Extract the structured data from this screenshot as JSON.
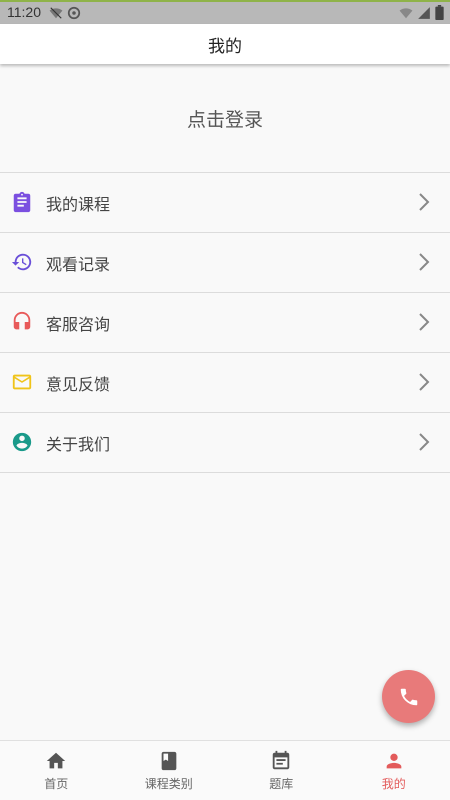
{
  "status_bar": {
    "time": "11:20"
  },
  "app_bar": {
    "title": "我的"
  },
  "login": {
    "label": "点击登录"
  },
  "menu": {
    "items": [
      {
        "label": "我的课程",
        "icon": "clipboard-icon",
        "color": "#7b4fe0"
      },
      {
        "label": "观看记录",
        "icon": "history-icon",
        "color": "#6a4fd8"
      },
      {
        "label": "客服咨询",
        "icon": "headset-icon",
        "color": "#e85a5a"
      },
      {
        "label": "意见反馈",
        "icon": "mail-icon",
        "color": "#f0c419"
      },
      {
        "label": "关于我们",
        "icon": "account-circle-icon",
        "color": "#1a9a8a"
      }
    ]
  },
  "fab": {
    "icon": "phone-icon",
    "color": "#e87a7a"
  },
  "bottom_nav": {
    "items": [
      {
        "label": "首页",
        "icon": "home-icon"
      },
      {
        "label": "课程类别",
        "icon": "book-icon"
      },
      {
        "label": "题库",
        "icon": "calendar-list-icon"
      },
      {
        "label": "我的",
        "icon": "person-icon",
        "active": true
      }
    ],
    "active_color": "#e35b5b"
  }
}
